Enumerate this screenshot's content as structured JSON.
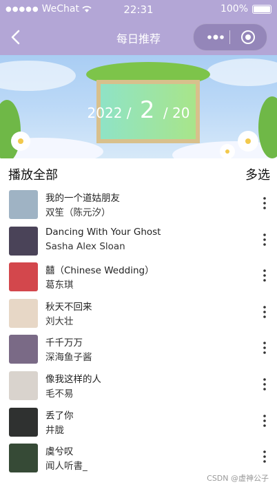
{
  "statusbar": {
    "carrier": "WeChat",
    "time": "22:31",
    "battery": "100%"
  },
  "nav": {
    "title": "每日推荐"
  },
  "banner": {
    "year": "2022",
    "month": "2",
    "day": "20"
  },
  "list": {
    "play_all": "播放全部",
    "multi_select": "多选",
    "songs": [
      {
        "title": "我的一个道姑朋友",
        "artist": "双笙（陈元汐）",
        "cover": "#9fb3c4"
      },
      {
        "title": "Dancing With Your Ghost",
        "artist": "Sasha Alex Sloan",
        "cover": "#4a4358"
      },
      {
        "title": "囍（Chinese Wedding）",
        "artist": "葛东琪",
        "cover": "#d3474c"
      },
      {
        "title": "秋天不回来",
        "artist": "刘大壮",
        "cover": "#e7d7c6"
      },
      {
        "title": "千千万万",
        "artist": "深海鱼子酱",
        "cover": "#7a6a86"
      },
      {
        "title": "像我这样的人",
        "artist": "毛不易",
        "cover": "#d9d3cd"
      },
      {
        "title": "丢了你",
        "artist": "井胧",
        "cover": "#2f3130"
      },
      {
        "title": "虞兮叹",
        "artist": "闻人听書_",
        "cover": "#364a36"
      }
    ]
  },
  "watermark": "CSDN @虚神公子"
}
